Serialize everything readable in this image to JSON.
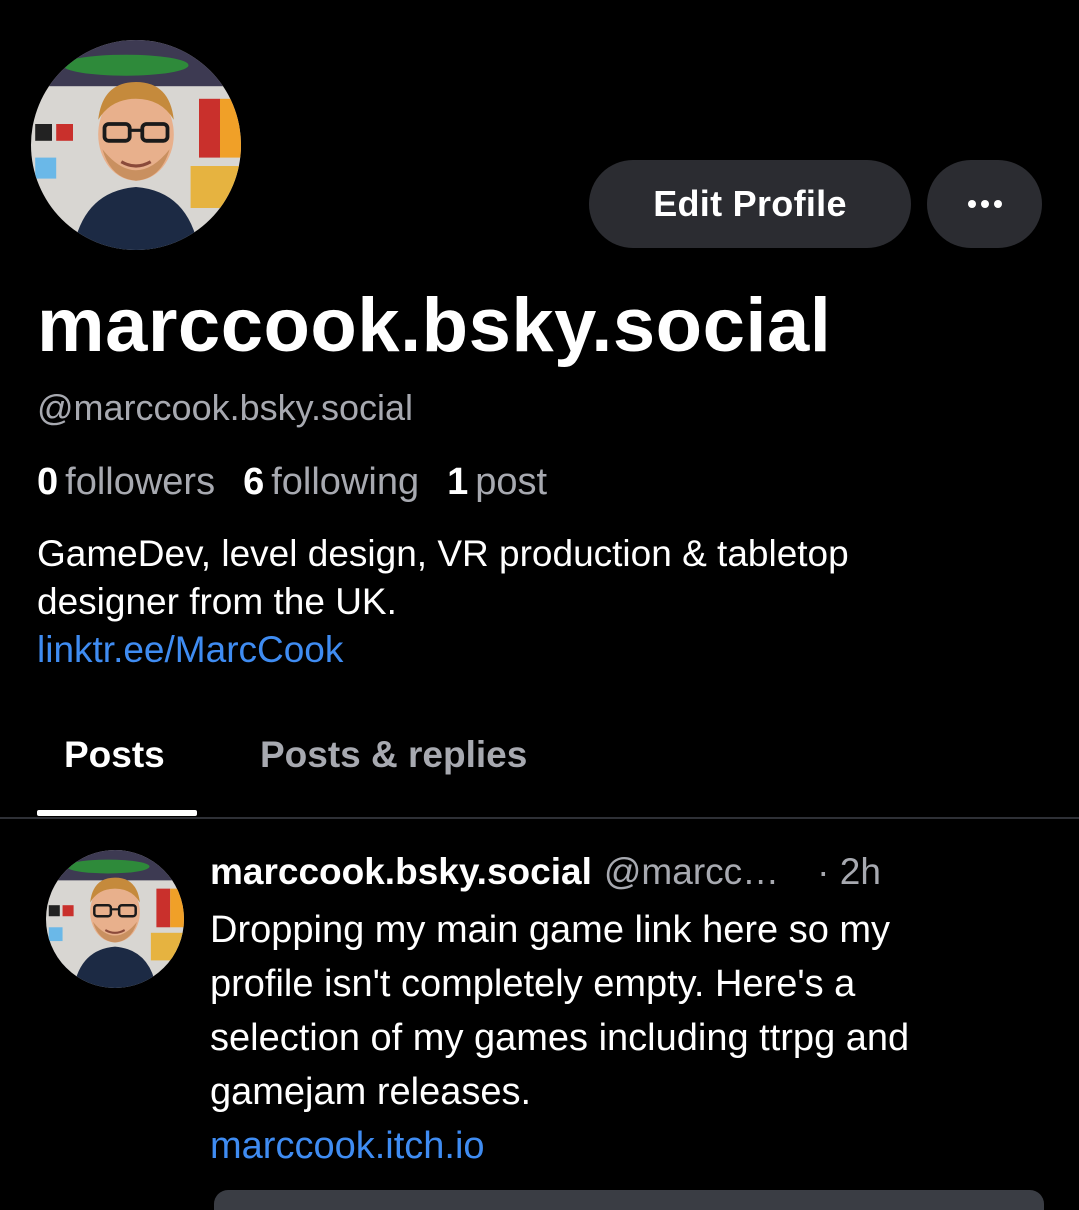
{
  "profile": {
    "display_name": "marccook.bsky.social",
    "handle": "@marccook.bsky.social",
    "stats": {
      "followers_count": "0",
      "followers_label": "followers",
      "following_count": "6",
      "following_label": "following",
      "posts_count": "1",
      "posts_label": "post"
    },
    "bio_line1": "GameDev, level design, VR production & tabletop",
    "bio_line2": "designer from the UK.",
    "bio_link": "linktr.ee/MarcCook",
    "edit_button_label": "Edit Profile",
    "more_button_icon": "ellipsis-icon"
  },
  "tabs": [
    {
      "label": "Posts",
      "active": true
    },
    {
      "label": "Posts & replies",
      "active": false
    }
  ],
  "post": {
    "author": "marccook.bsky.social",
    "handle": "@marcc…",
    "time": "· 2h",
    "text_lines": [
      "Dropping my main game link here so my",
      "profile isn't completely empty. Here's a",
      "selection of my games including ttrpg and",
      "gamejam releases."
    ],
    "link": "marccook.itch.io"
  },
  "colors": {
    "background": "#000000",
    "button_bg": "#2b2c31",
    "secondary_text": "#a7a9b0",
    "link": "#3f8cf2"
  }
}
